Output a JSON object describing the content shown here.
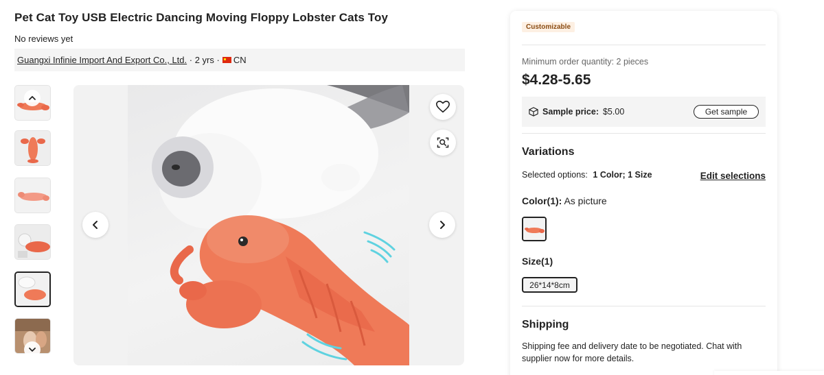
{
  "product": {
    "title": "Pet Cat Toy USB Electric Dancing Moving Floppy Lobster Cats Toy",
    "reviews": "No reviews yet"
  },
  "supplier": {
    "name": "Guangxi Infinie Import And Export Co., Ltd.",
    "years": "· 2 yrs ·",
    "country": "CN"
  },
  "gallery": {
    "thumb_count": 6,
    "selected_index": 4
  },
  "panel": {
    "badge": "Customizable",
    "moq": "Minimum order quantity: 2 pieces",
    "price": "$4.28-5.65",
    "sample_label": "Sample price:",
    "sample_value": "$5.00",
    "get_sample": "Get sample",
    "variations_heading": "Variations",
    "selected_options_label": "Selected options:",
    "selected_options_value": "1 Color; 1 Size",
    "edit_selections": "Edit selections",
    "color_label": "Color(1):",
    "color_value": "As picture",
    "size_label": "Size(1)",
    "size_value": "26*14*8cm",
    "shipping_heading": "Shipping",
    "shipping_text": "Shipping fee and delivery date to be negotiated. Chat with supplier now for more details."
  },
  "icons": {
    "favorite": "heart-icon",
    "image_search": "image-search-icon",
    "prev": "chevron-left-icon",
    "next": "chevron-right-icon",
    "thumb_up": "chevron-up-icon",
    "thumb_down": "chevron-down-icon",
    "sample": "box-icon"
  },
  "colors": {
    "lobster": "#f07a5a",
    "badge_bg": "#fdf0e3",
    "badge_text": "#8a4b12",
    "sound_wave": "#5fd2e0"
  }
}
